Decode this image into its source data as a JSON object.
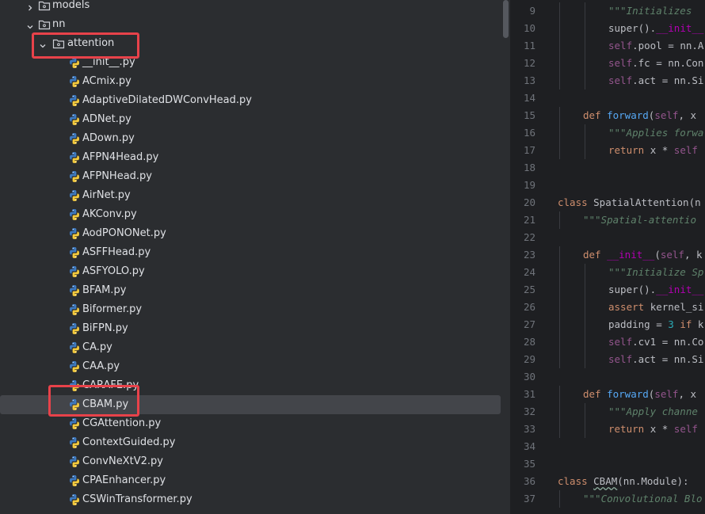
{
  "tree": {
    "items": [
      {
        "label": "models",
        "kind": "folder",
        "expanded": false
      },
      {
        "label": "nn",
        "kind": "folder",
        "expanded": true
      },
      {
        "label": "attention",
        "kind": "folder",
        "expanded": true,
        "highlighted": true
      },
      {
        "label": "__init__.py",
        "kind": "python"
      },
      {
        "label": "ACmix.py",
        "kind": "python"
      },
      {
        "label": "AdaptiveDilatedDWConvHead.py",
        "kind": "python"
      },
      {
        "label": "ADNet.py",
        "kind": "python"
      },
      {
        "label": "ADown.py",
        "kind": "python"
      },
      {
        "label": "AFPN4Head.py",
        "kind": "python"
      },
      {
        "label": "AFPNHead.py",
        "kind": "python"
      },
      {
        "label": "AirNet.py",
        "kind": "python"
      },
      {
        "label": "AKConv.py",
        "kind": "python"
      },
      {
        "label": "AodPONONet.py",
        "kind": "python"
      },
      {
        "label": "ASFFHead.py",
        "kind": "python"
      },
      {
        "label": "ASFYOLO.py",
        "kind": "python"
      },
      {
        "label": "BFAM.py",
        "kind": "python"
      },
      {
        "label": "Biformer.py",
        "kind": "python"
      },
      {
        "label": "BiFPN.py",
        "kind": "python"
      },
      {
        "label": "CA.py",
        "kind": "python"
      },
      {
        "label": "CAA.py",
        "kind": "python"
      },
      {
        "label": "CARAFE.py",
        "kind": "python"
      },
      {
        "label": "CBAM.py",
        "kind": "python",
        "selected": true,
        "highlighted": true
      },
      {
        "label": "CGAttention.py",
        "kind": "python"
      },
      {
        "label": "ContextGuided.py",
        "kind": "python"
      },
      {
        "label": "ConvNeXtV2.py",
        "kind": "python"
      },
      {
        "label": "CPAEnhancer.py",
        "kind": "python"
      },
      {
        "label": "CSWinTransformer.py",
        "kind": "python"
      }
    ],
    "highlight_color": "#e8424a"
  },
  "editor": {
    "lines": [
      {
        "n": "9",
        "indent": 2,
        "tokens": [
          [
            "doc",
            "\"\"\"Initializes "
          ]
        ]
      },
      {
        "n": "10",
        "indent": 2,
        "tokens": [
          [
            "",
            "super()."
          ],
          [
            "dunder",
            "__init__"
          ]
        ]
      },
      {
        "n": "11",
        "indent": 2,
        "tokens": [
          [
            "self",
            "self"
          ],
          [
            "",
            ".pool = nn.A"
          ]
        ]
      },
      {
        "n": "12",
        "indent": 2,
        "tokens": [
          [
            "self",
            "self"
          ],
          [
            "",
            ".fc = nn.Con"
          ]
        ]
      },
      {
        "n": "13",
        "indent": 2,
        "tokens": [
          [
            "self",
            "self"
          ],
          [
            "",
            ".act = nn.Si"
          ]
        ]
      },
      {
        "n": "14",
        "indent": 0,
        "tokens": []
      },
      {
        "n": "15",
        "indent": 1,
        "tokens": [
          [
            "kw",
            "def "
          ],
          [
            "fn",
            "forward"
          ],
          [
            "",
            "("
          ],
          [
            "self",
            "self"
          ],
          [
            "",
            ", x"
          ]
        ]
      },
      {
        "n": "16",
        "indent": 2,
        "tokens": [
          [
            "doc",
            "\"\"\"Applies forwa"
          ]
        ]
      },
      {
        "n": "17",
        "indent": 2,
        "tokens": [
          [
            "kw",
            "return "
          ],
          [
            "",
            "x * "
          ],
          [
            "self",
            "self"
          ]
        ]
      },
      {
        "n": "18",
        "indent": 0,
        "tokens": []
      },
      {
        "n": "19",
        "indent": 0,
        "tokens": []
      },
      {
        "n": "20",
        "indent": 0,
        "tokens": [
          [
            "kw",
            "class "
          ],
          [
            "",
            "SpatialAttention(n"
          ]
        ]
      },
      {
        "n": "21",
        "indent": 1,
        "tokens": [
          [
            "doc",
            "\"\"\"Spatial-attentio"
          ]
        ]
      },
      {
        "n": "22",
        "indent": 0,
        "tokens": []
      },
      {
        "n": "23",
        "indent": 1,
        "tokens": [
          [
            "kw",
            "def "
          ],
          [
            "dunder",
            "__init__"
          ],
          [
            "",
            "("
          ],
          [
            "self",
            "self"
          ],
          [
            "",
            ", k"
          ]
        ]
      },
      {
        "n": "24",
        "indent": 2,
        "tokens": [
          [
            "doc",
            "\"\"\"Initialize Sp"
          ]
        ]
      },
      {
        "n": "25",
        "indent": 2,
        "tokens": [
          [
            "",
            "super()."
          ],
          [
            "dunder",
            "__init__"
          ],
          [
            "",
            "("
          ]
        ]
      },
      {
        "n": "26",
        "indent": 2,
        "tokens": [
          [
            "kw",
            "assert "
          ],
          [
            "",
            "kernel_si"
          ]
        ]
      },
      {
        "n": "27",
        "indent": 2,
        "tokens": [
          [
            "",
            "padding = "
          ],
          [
            "num",
            "3"
          ],
          [
            "kw",
            " if "
          ],
          [
            "",
            "k"
          ]
        ]
      },
      {
        "n": "28",
        "indent": 2,
        "tokens": [
          [
            "self",
            "self"
          ],
          [
            "",
            ".cv1 = nn.Co"
          ]
        ]
      },
      {
        "n": "29",
        "indent": 2,
        "tokens": [
          [
            "self",
            "self"
          ],
          [
            "",
            ".act = nn.Si"
          ]
        ]
      },
      {
        "n": "30",
        "indent": 0,
        "tokens": []
      },
      {
        "n": "31",
        "indent": 1,
        "tokens": [
          [
            "kw",
            "def "
          ],
          [
            "fn",
            "forward"
          ],
          [
            "",
            "("
          ],
          [
            "self",
            "self"
          ],
          [
            "",
            ", x"
          ]
        ]
      },
      {
        "n": "32",
        "indent": 2,
        "tokens": [
          [
            "doc",
            "\"\"\"Apply channe"
          ]
        ]
      },
      {
        "n": "33",
        "indent": 2,
        "tokens": [
          [
            "kw",
            "return "
          ],
          [
            "",
            "x * "
          ],
          [
            "self",
            "self"
          ]
        ]
      },
      {
        "n": "34",
        "indent": 0,
        "tokens": []
      },
      {
        "n": "35",
        "indent": 0,
        "tokens": []
      },
      {
        "n": "36",
        "indent": 0,
        "tokens": [
          [
            "kw",
            "class "
          ],
          [
            "squig",
            "CBAM"
          ],
          [
            "",
            "(nn.Module):"
          ]
        ]
      },
      {
        "n": "37",
        "indent": 1,
        "tokens": [
          [
            "doc",
            "\"\"\"Convolutional Blo"
          ]
        ]
      }
    ]
  }
}
